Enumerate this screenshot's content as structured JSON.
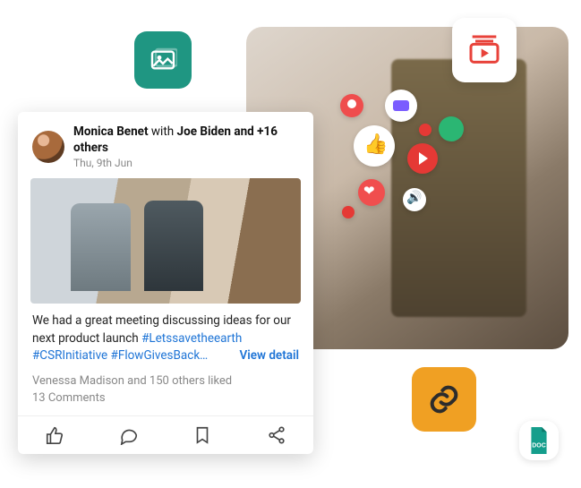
{
  "post": {
    "author": "Monica Benet",
    "with_word": "with",
    "tagged": "Joe Biden and +16 others",
    "date": "Thu, 9th Jun",
    "caption_text": "We had a great meeting discussing ideas for our next product launch ",
    "hashtags": "#Letssavetheearth #CSRInitiative #FlowGivesBack…",
    "view_detail": "View detail",
    "likes_line": "Venessa Madison and 150 others liked",
    "comments_line": "13 Comments"
  },
  "tiles": {
    "image_icon": "image-icon",
    "video_icon": "video-library-icon",
    "link_icon": "link-icon",
    "doc_icon": "doc-file-icon",
    "doc_label": "DOC"
  },
  "colors": {
    "teal": "#1f9682",
    "amber": "#f0a023",
    "red": "#e8423a",
    "doc_teal": "#159e8c",
    "hashtag": "#1e74d6"
  }
}
